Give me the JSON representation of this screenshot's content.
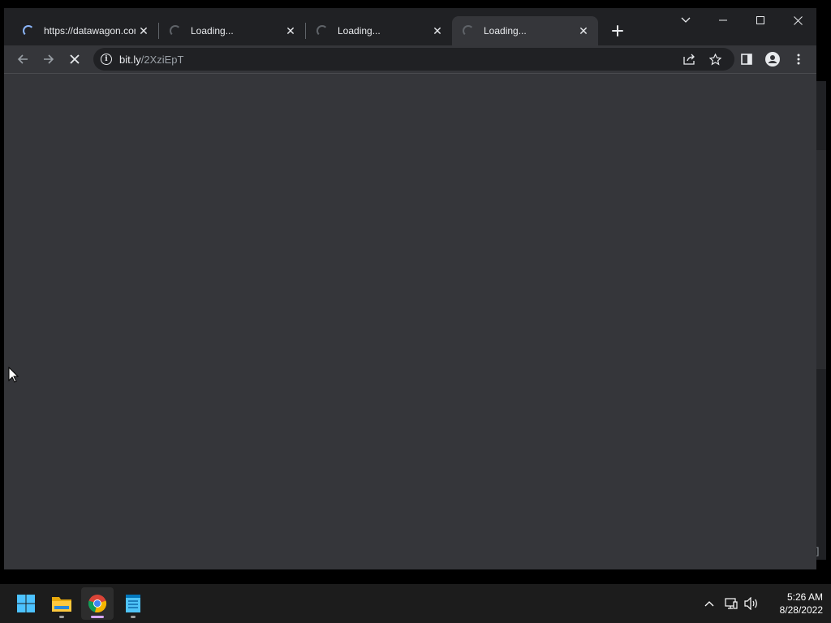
{
  "browser": {
    "tabs": [
      {
        "title": "https://datawagon.com",
        "active": false
      },
      {
        "title": "Loading...",
        "active": false
      },
      {
        "title": "Loading...",
        "active": false
      },
      {
        "title": "Loading...",
        "active": true
      }
    ],
    "address": {
      "host": "bit.ly",
      "path": "/2XziEpT"
    },
    "icons": {
      "back": "arrow-left-icon",
      "forward": "arrow-right-icon",
      "stop": "close-icon",
      "site_info": "info-icon",
      "share": "share-icon",
      "bookmark": "star-icon",
      "side_panel": "side-panel-icon",
      "profile": "person-icon",
      "menu": "kebab-menu-icon",
      "new_tab": "plus-icon",
      "tab_search": "chevron-down-icon"
    }
  },
  "taskbar": {
    "time": "5:26 AM",
    "date": "8/28/2022",
    "apps": [
      "start",
      "file-explorer",
      "chrome",
      "notepad"
    ]
  },
  "colors": {
    "tab_active": "#35363a",
    "tab_strip": "#202124",
    "accent_blue": "#8ab4f8",
    "taskbar": "#1c1c1c"
  }
}
